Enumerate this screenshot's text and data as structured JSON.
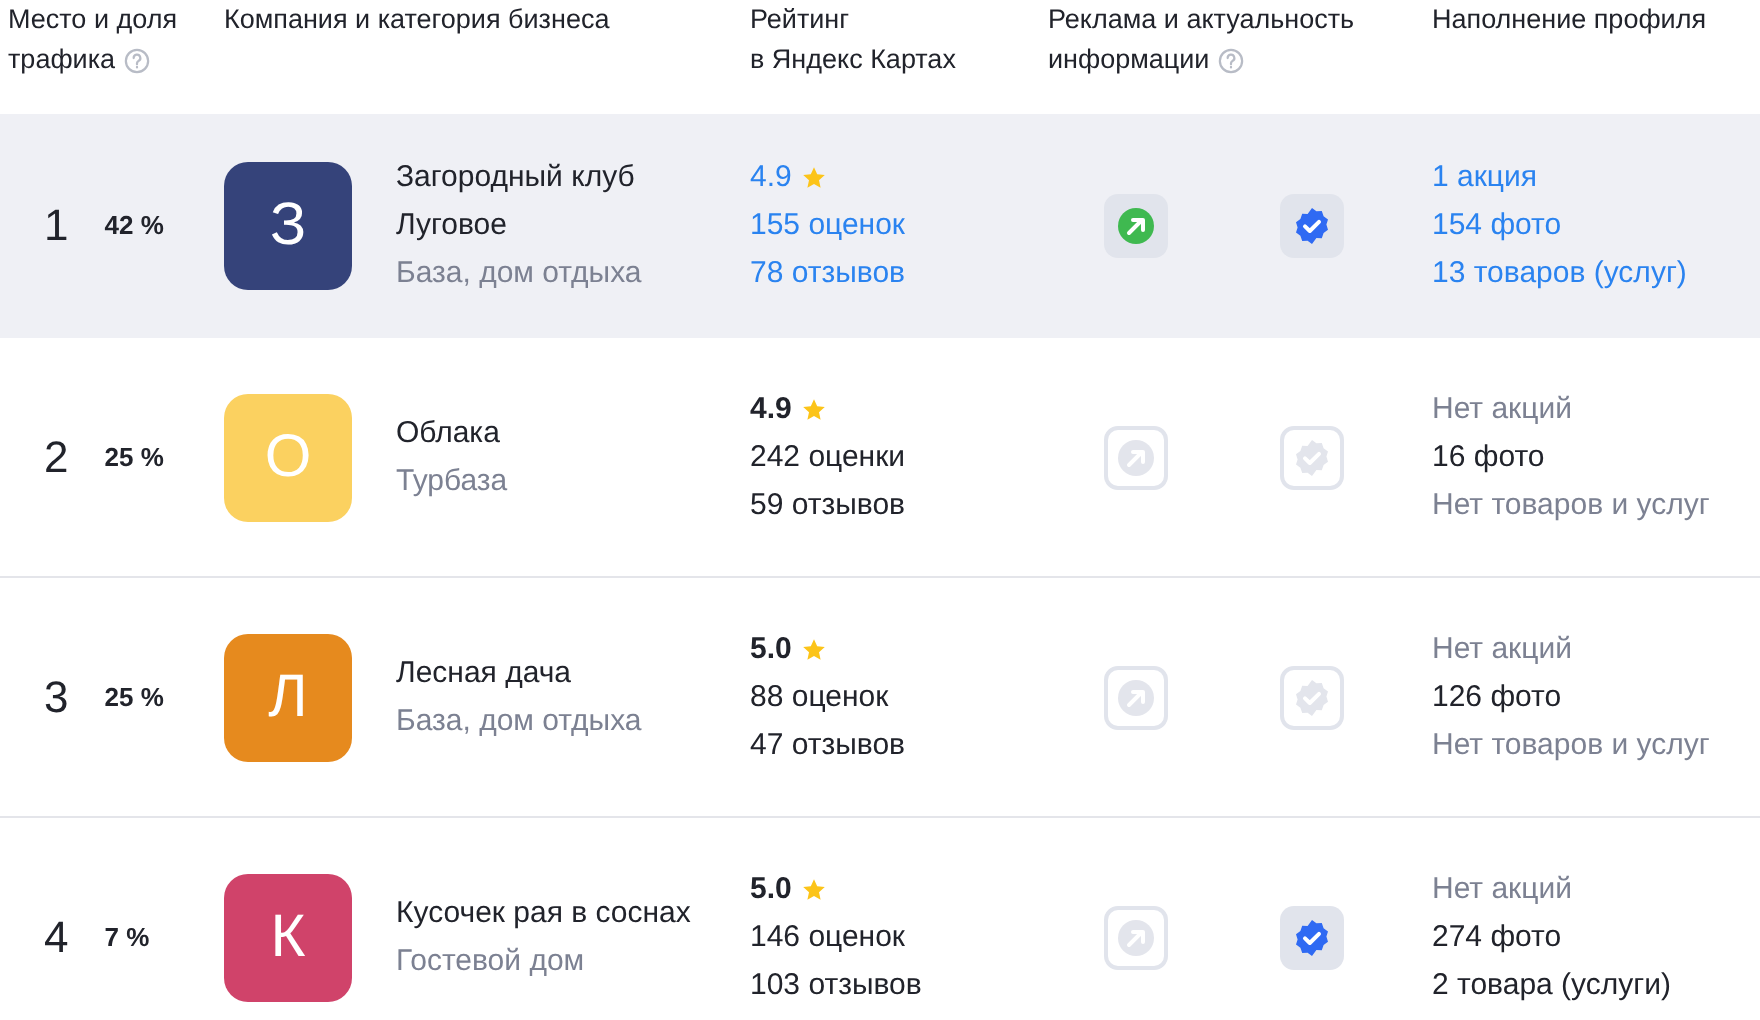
{
  "columns": [
    {
      "lines": [
        "Место и доля",
        "трафика"
      ],
      "help": true
    },
    {
      "lines": [
        "Компания и категория бизнеса"
      ]
    },
    {
      "lines": [
        "Рейтинг",
        "в Яндекс Картах"
      ]
    },
    {
      "lines": [
        "Реклама и актуальность",
        "информации"
      ],
      "help": true
    },
    {
      "lines": [
        "Наполнение профиля"
      ]
    }
  ],
  "rows": [
    {
      "selected": true,
      "place": "1",
      "share": "42 %",
      "logo_letter": "З",
      "color": "#35437a",
      "name": "Загородный клуб Луговое",
      "category": "База, дом отдыха",
      "rating": "4.9",
      "rating_linked": true,
      "ratings_count": "155 оценок",
      "reviews": "78 отзывов",
      "ad_active": true,
      "verified": true,
      "profile": [
        {
          "kind": "link",
          "text": "1 акция"
        },
        {
          "kind": "link",
          "text": "154 фото"
        },
        {
          "kind": "link",
          "text": "13 товаров (услуг)"
        }
      ]
    },
    {
      "selected": false,
      "place": "2",
      "share": "25 %",
      "logo_letter": "О",
      "color": "#fbd160",
      "name": "Облака",
      "category": "Турбаза",
      "rating": "4.9",
      "rating_linked": false,
      "ratings_count": "242 оценки",
      "reviews": "59 отзывов",
      "ad_active": false,
      "verified": false,
      "profile": [
        {
          "kind": "muted",
          "text": "Нет акций"
        },
        {
          "kind": "plain",
          "text": "16 фото"
        },
        {
          "kind": "muted",
          "text": "Нет товаров и услуг"
        }
      ]
    },
    {
      "selected": false,
      "place": "3",
      "share": "25 %",
      "logo_letter": "Л",
      "color": "#e68a1e",
      "name": "Лесная дача",
      "category": "База, дом отдыха",
      "rating": "5.0",
      "rating_linked": false,
      "ratings_count": "88 оценок",
      "reviews": "47 отзывов",
      "ad_active": false,
      "verified": false,
      "profile": [
        {
          "kind": "muted",
          "text": "Нет акций"
        },
        {
          "kind": "plain",
          "text": "126 фото"
        },
        {
          "kind": "muted",
          "text": "Нет товаров и услуг"
        }
      ]
    },
    {
      "selected": false,
      "place": "4",
      "share": "7 %",
      "logo_letter": "К",
      "color": "#d0436a",
      "name": "Кусочек рая в соснах",
      "category": "Гостевой дом",
      "rating": "5.0",
      "rating_linked": false,
      "ratings_count": "146 оценок",
      "reviews": "103 отзывов",
      "ad_active": false,
      "verified": true,
      "profile": [
        {
          "kind": "muted",
          "text": "Нет акций"
        },
        {
          "kind": "plain",
          "text": "274 фото"
        },
        {
          "kind": "plain",
          "text": "2 товара (услуги)"
        }
      ]
    }
  ]
}
